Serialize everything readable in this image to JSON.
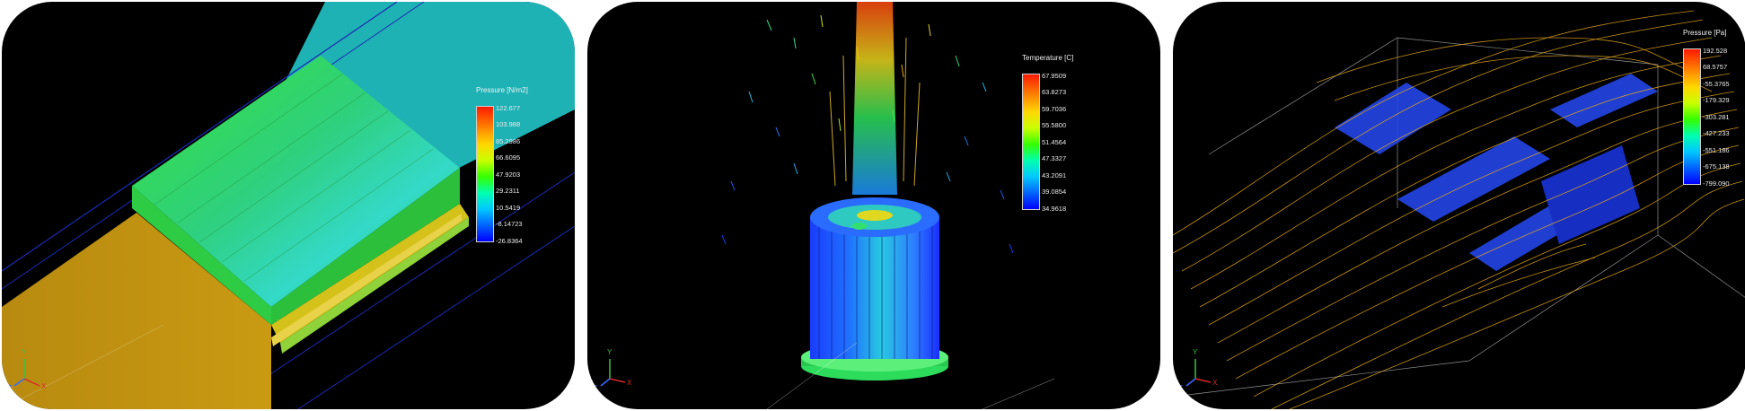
{
  "panels": [
    {
      "legend": {
        "title": "Pressure [N/m2]",
        "ticks": [
          "122.677",
          "103.988",
          "85.2986",
          "66.6095",
          "47.9203",
          "29.2311",
          "10.5419",
          "-8.14723",
          "-26.8364"
        ]
      },
      "axes": {
        "x": "X",
        "y": "Y",
        "z": "Z"
      }
    },
    {
      "legend": {
        "title": "Temperature [C]",
        "ticks": [
          "67.9509",
          "63.8273",
          "59.7036",
          "55.5800",
          "51.4564",
          "47.3327",
          "43.2091",
          "39.0854",
          "34.9618"
        ]
      },
      "axes": {
        "x": "X",
        "y": "Y",
        "z": "Z"
      }
    },
    {
      "legend": {
        "title": "Pressure [Pa]",
        "ticks": [
          "192.528",
          "68.5757",
          "-55.3765",
          "-179.329",
          "-303.281",
          "-427.233",
          "-551.186",
          "-675.138",
          "-799.090"
        ]
      },
      "axes": {
        "x": "X",
        "y": "Y",
        "z": "Z"
      }
    }
  ]
}
